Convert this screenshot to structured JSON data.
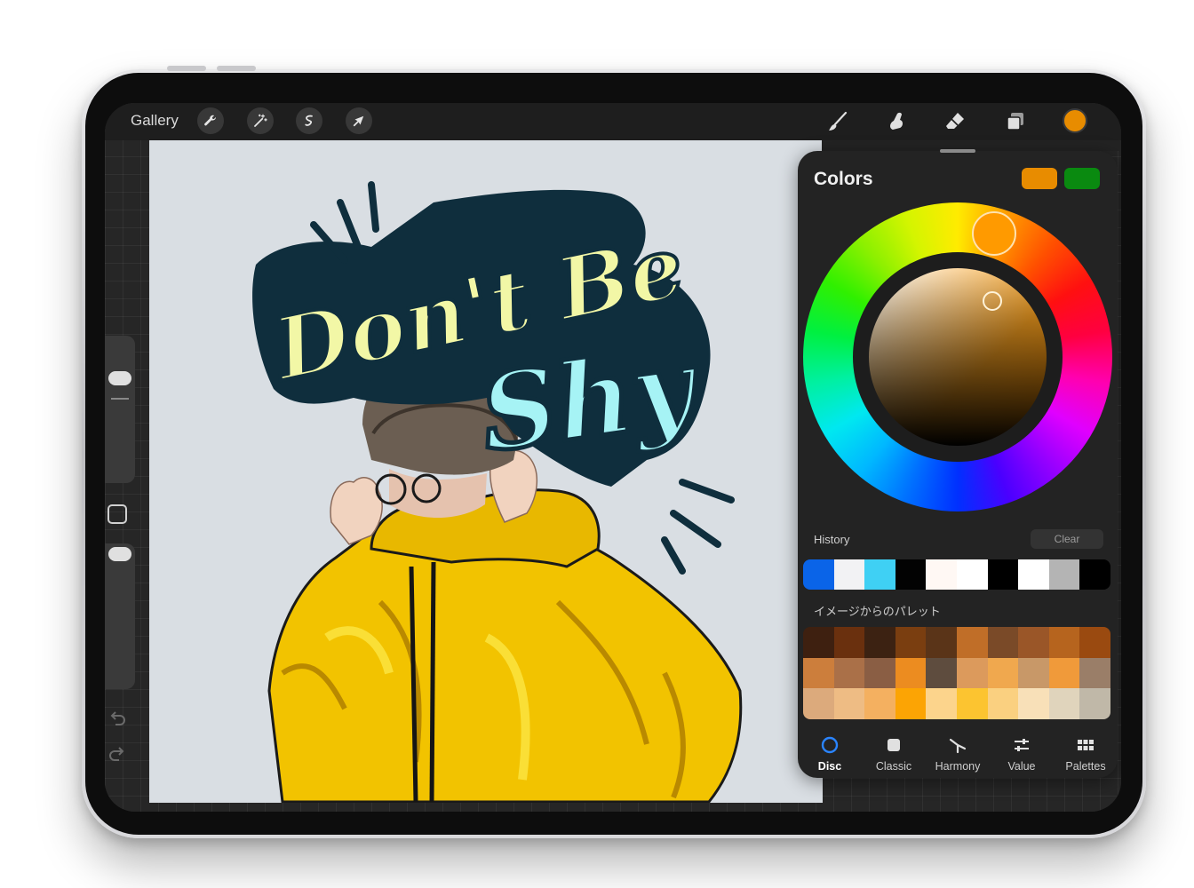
{
  "toolbar": {
    "gallery_label": "Gallery",
    "left_tools": [
      "wrench-icon",
      "magic-wand-icon",
      "selection-icon",
      "arrow-icon"
    ],
    "right_tools": [
      "brush-icon",
      "smudge-icon",
      "eraser-icon",
      "layers-icon"
    ],
    "current_color": "#e88c00"
  },
  "canvas": {
    "artwork_text_line1": "Don't Be",
    "artwork_text_line2": "Shy",
    "background": "#d9dee3"
  },
  "colors_panel": {
    "title": "Colors",
    "primary_swatch": "#e88c00",
    "secondary_swatch": "#0a8a10",
    "history_label": "History",
    "clear_label": "Clear",
    "history": [
      "#0a64e8",
      "#f2f2f4",
      "#3fd0f4",
      "#020202",
      "#fff8f4",
      "#ffffff",
      "#000000",
      "#ffffff",
      "#b4b4b4",
      "#000000"
    ],
    "palette_label": "イメージからのパレット",
    "palette": [
      "#3e2010",
      "#6a300e",
      "#3c2212",
      "#7a3e10",
      "#5a3418",
      "#c06e28",
      "#7a4a28",
      "#9a5628",
      "#b6641e",
      "#9a4a10",
      "#cc7e3c",
      "#aa7048",
      "#8a5e44",
      "#ec8c20",
      "#5e4c3e",
      "#dc9a5c",
      "#f0a84e",
      "#c89868",
      "#f09a3a",
      "#9a7e68",
      "#dcaa7c",
      "#eebc84",
      "#f4b060",
      "#fca404",
      "#fcd48c",
      "#fcc430",
      "#fad080",
      "#f8e0b8",
      "#e0d4bc",
      "#c0b8a8"
    ],
    "tabs": [
      {
        "label": "Disc",
        "icon": "disc-icon",
        "active": true
      },
      {
        "label": "Classic",
        "icon": "classic-square-icon",
        "active": false
      },
      {
        "label": "Harmony",
        "icon": "harmony-icon",
        "active": false
      },
      {
        "label": "Value",
        "icon": "sliders-icon",
        "active": false
      },
      {
        "label": "Palettes",
        "icon": "palettes-grid-icon",
        "active": false
      }
    ]
  }
}
